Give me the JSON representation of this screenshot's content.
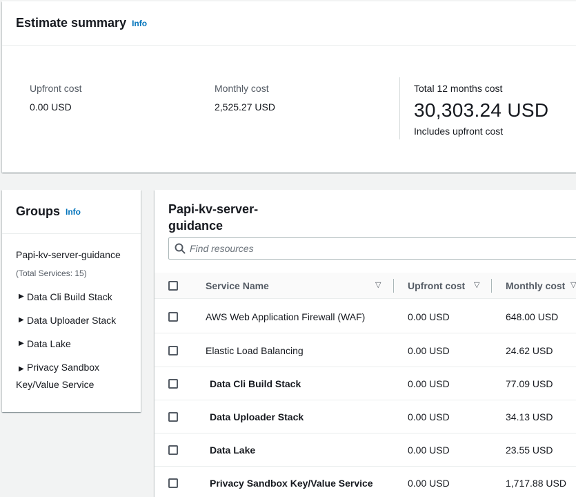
{
  "summary": {
    "title": "Estimate summary",
    "info": "Info",
    "upfront_label": "Upfront cost",
    "upfront_value": "0.00 USD",
    "monthly_label": "Monthly cost",
    "monthly_value": "2,525.27 USD",
    "total_label": "Total 12 months cost",
    "total_value": "30,303.24 USD",
    "total_note": "Includes upfront cost"
  },
  "groups": {
    "title": "Groups",
    "info": "Info",
    "root_name": "Papi-kv-server-guidance",
    "root_count": "(Total Services: 15)",
    "items": [
      {
        "label": "Data Cli Build Stack"
      },
      {
        "label": "Data Uploader Stack"
      },
      {
        "label": "Data Lake"
      },
      {
        "label": "Privacy Sandbox Key/Value Service"
      }
    ]
  },
  "resources": {
    "title": "Papi-kv-server-guidance",
    "search_placeholder": "Find resources",
    "columns": {
      "service": "Service Name",
      "upfront": "Upfront cost",
      "monthly": "Monthly cost"
    },
    "rows": [
      {
        "service": "AWS Web Application Firewall (WAF)",
        "upfront": "0.00 USD",
        "monthly": "648.00 USD",
        "is_group": false
      },
      {
        "service": "Elastic Load Balancing",
        "upfront": "0.00 USD",
        "monthly": "24.62 USD",
        "is_group": false
      },
      {
        "service": "Data Cli Build Stack",
        "upfront": "0.00 USD",
        "monthly": "77.09 USD",
        "is_group": true
      },
      {
        "service": "Data Uploader Stack",
        "upfront": "0.00 USD",
        "monthly": "34.13 USD",
        "is_group": true
      },
      {
        "service": "Data Lake",
        "upfront": "0.00 USD",
        "monthly": "23.55 USD",
        "is_group": true
      },
      {
        "service": "Privacy Sandbox Key/Value Service",
        "upfront": "0.00 USD",
        "monthly": "1,717.88 USD",
        "is_group": true
      }
    ]
  },
  "icons": {
    "expand": "caret-right-icon",
    "sort": "sort-down-icon",
    "search": "search-icon"
  },
  "colors": {
    "link": "#0073bb",
    "background": "#f2f3f3",
    "text": "#16191f",
    "muted": "#545b64"
  }
}
